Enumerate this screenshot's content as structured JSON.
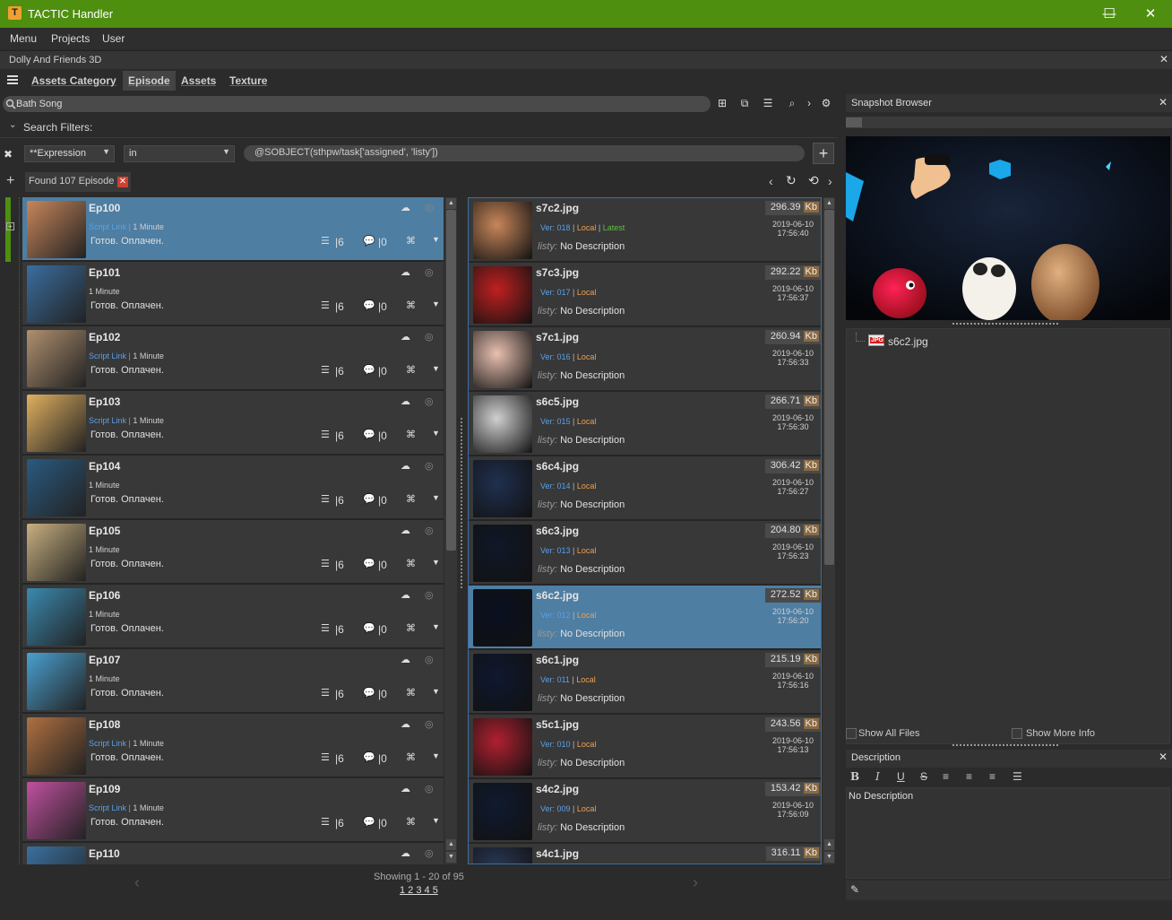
{
  "window": {
    "title": "TACTIC Handler",
    "minimize": "—",
    "maximize": "☐",
    "close": "✕"
  },
  "menu": [
    "Menu",
    "Projects",
    "User"
  ],
  "project": {
    "name": "Dolly And Friends 3D"
  },
  "tabs": [
    {
      "label": "Assets Category",
      "active": false
    },
    {
      "label": "Episode",
      "active": true
    },
    {
      "label": "Assets",
      "active": false
    },
    {
      "label": "Texture",
      "active": false
    }
  ],
  "search": {
    "value": "Bath Song"
  },
  "filters": {
    "header": "Search Filters:",
    "column": "**Expression",
    "operator": "in",
    "expression": "@SOBJECT(sthpw/task['assigned', 'listy'])"
  },
  "found": {
    "label": "Found 107 Episode"
  },
  "episodes": [
    {
      "name": "Ep100",
      "script_link": "Script Link",
      "duration": "1 Minute",
      "status": "Готов. Оплачен.",
      "files": "6",
      "notes": "0",
      "selected": true
    },
    {
      "name": "Ep101",
      "script_link": "",
      "duration": "1 Minute",
      "status": "Готов. Оплачен.",
      "files": "6",
      "notes": "0",
      "selected": false
    },
    {
      "name": "Ep102",
      "script_link": "Script Link",
      "duration": "1 Minute",
      "status": "Готов. Оплачен.",
      "files": "6",
      "notes": "0",
      "selected": false
    },
    {
      "name": "Ep103",
      "script_link": "Script Link",
      "duration": "1 Minute",
      "status": "Готов. Оплачен.",
      "files": "6",
      "notes": "0",
      "selected": false
    },
    {
      "name": "Ep104",
      "script_link": "",
      "duration": "1 Minute",
      "status": "Готов. Оплачен.",
      "files": "6",
      "notes": "0",
      "selected": false
    },
    {
      "name": "Ep105",
      "script_link": "",
      "duration": "1 Minute",
      "status": "Готов. Оплачен.",
      "files": "6",
      "notes": "0",
      "selected": false
    },
    {
      "name": "Ep106",
      "script_link": "",
      "duration": "1 Minute",
      "status": "Готов. Оплачен.",
      "files": "6",
      "notes": "0",
      "selected": false
    },
    {
      "name": "Ep107",
      "script_link": "",
      "duration": "1 Minute",
      "status": "Готов. Оплачен.",
      "files": "6",
      "notes": "0",
      "selected": false
    },
    {
      "name": "Ep108",
      "script_link": "Script Link",
      "duration": "1 Minute",
      "status": "Готов. Оплачен.",
      "files": "6",
      "notes": "0",
      "selected": false
    },
    {
      "name": "Ep109",
      "script_link": "Script Link",
      "duration": "1 Minute",
      "status": "Готов. Оплачен.",
      "files": "6",
      "notes": "0",
      "selected": false
    },
    {
      "name": "Ep110",
      "script_link": "",
      "duration": "",
      "status": "",
      "files": "",
      "notes": "",
      "selected": false
    }
  ],
  "snapshots": [
    {
      "name": "s7c2.jpg",
      "ver": "Ver: 018",
      "local": "Local",
      "latest": "Latest",
      "desc_label": "listy:",
      "desc": "No Description",
      "size": "296.39",
      "unit": "Kb",
      "date": "2019-06-10",
      "time": "17:56:40",
      "selected": false
    },
    {
      "name": "s7c3.jpg",
      "ver": "Ver: 017",
      "local": "Local",
      "latest": "",
      "desc_label": "listy:",
      "desc": "No Description",
      "size": "292.22",
      "unit": "Kb",
      "date": "2019-06-10",
      "time": "17:56:37",
      "selected": false
    },
    {
      "name": "s7c1.jpg",
      "ver": "Ver: 016",
      "local": "Local",
      "latest": "",
      "desc_label": "listy:",
      "desc": "No Description",
      "size": "260.94",
      "unit": "Kb",
      "date": "2019-06-10",
      "time": "17:56:33",
      "selected": false
    },
    {
      "name": "s6c5.jpg",
      "ver": "Ver: 015",
      "local": "Local",
      "latest": "",
      "desc_label": "listy:",
      "desc": "No Description",
      "size": "266.71",
      "unit": "Kb",
      "date": "2019-06-10",
      "time": "17:56:30",
      "selected": false
    },
    {
      "name": "s6c4.jpg",
      "ver": "Ver: 014",
      "local": "Local",
      "latest": "",
      "desc_label": "listy:",
      "desc": "No Description",
      "size": "306.42",
      "unit": "Kb",
      "date": "2019-06-10",
      "time": "17:56:27",
      "selected": false
    },
    {
      "name": "s6c3.jpg",
      "ver": "Ver: 013",
      "local": "Local",
      "latest": "",
      "desc_label": "listy:",
      "desc": "No Description",
      "size": "204.80",
      "unit": "Kb",
      "date": "2019-06-10",
      "time": "17:56:23",
      "selected": false
    },
    {
      "name": "s6c2.jpg",
      "ver": "Ver: 012",
      "local": "Local",
      "latest": "",
      "desc_label": "listy:",
      "desc": "No Description",
      "size": "272.52",
      "unit": "Kb",
      "date": "2019-06-10",
      "time": "17:56:20",
      "selected": true
    },
    {
      "name": "s6c1.jpg",
      "ver": "Ver: 011",
      "local": "Local",
      "latest": "",
      "desc_label": "listy:",
      "desc": "No Description",
      "size": "215.19",
      "unit": "Kb",
      "date": "2019-06-10",
      "time": "17:56:16",
      "selected": false
    },
    {
      "name": "s5c1.jpg",
      "ver": "Ver: 010",
      "local": "Local",
      "latest": "",
      "desc_label": "listy:",
      "desc": "No Description",
      "size": "243.56",
      "unit": "Kb",
      "date": "2019-06-10",
      "time": "17:56:13",
      "selected": false
    },
    {
      "name": "s4c2.jpg",
      "ver": "Ver: 009",
      "local": "Local",
      "latest": "",
      "desc_label": "listy:",
      "desc": "No Description",
      "size": "153.42",
      "unit": "Kb",
      "date": "2019-06-10",
      "time": "17:56:09",
      "selected": false
    },
    {
      "name": "s4c1.jpg",
      "ver": "",
      "local": "",
      "latest": "",
      "desc_label": "",
      "desc": "",
      "size": "316.11",
      "unit": "Kb",
      "date": "",
      "time": "",
      "selected": false
    }
  ],
  "pager": {
    "showing": "Showing 1 - 20 of 95",
    "pages": "1 2 3 4 5"
  },
  "snapshot_browser": {
    "title": "Snapshot Browser",
    "file": {
      "badge": "JPG",
      "name": "s6c2.jpg"
    },
    "show_all_files": "Show All Files",
    "show_more_info": "Show More Info"
  },
  "description": {
    "title": "Description",
    "text": "No Description"
  },
  "colors": {
    "titlebar": "#4e8f10",
    "selection": "#4e7ea2",
    "link": "#5aa0e8",
    "local": "#f0a050",
    "latest": "#60c040"
  }
}
